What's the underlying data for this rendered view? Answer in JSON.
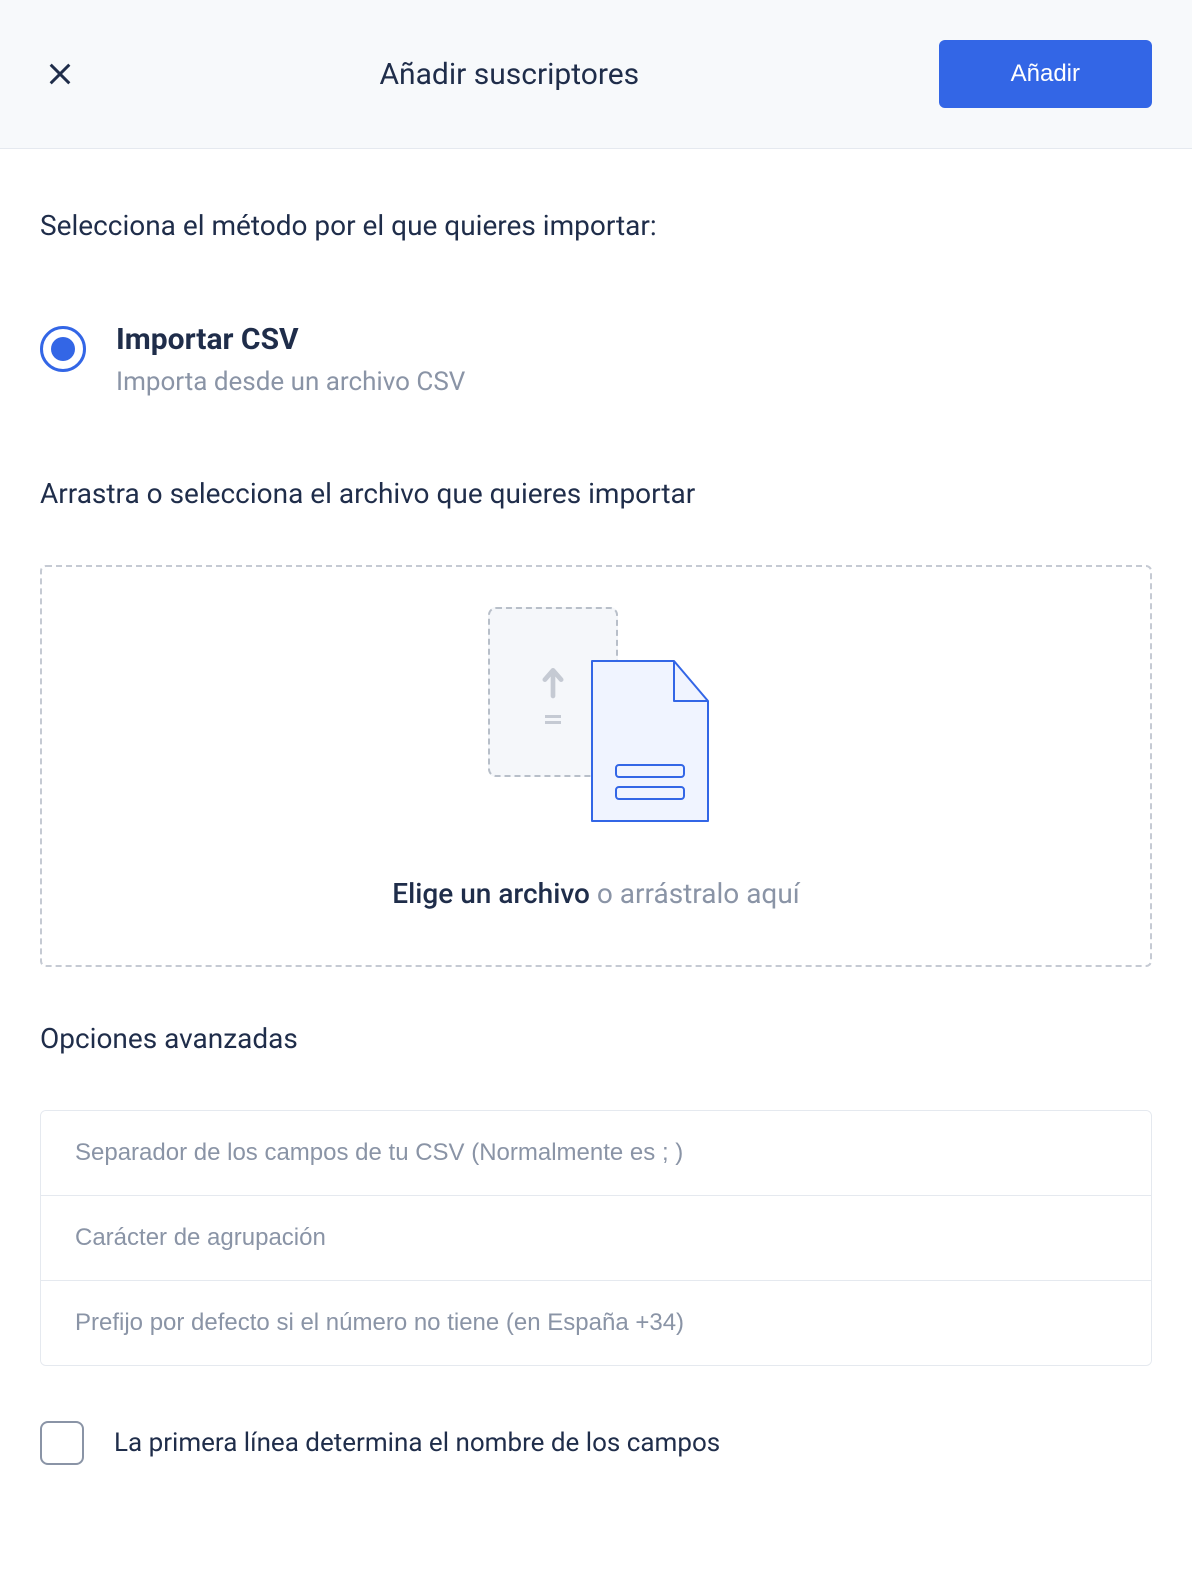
{
  "header": {
    "title": "Añadir suscriptores",
    "add_button": "Añadir"
  },
  "section": {
    "method_label": "Selecciona el método por el que quieres importar:",
    "import_csv": {
      "title": "Importar CSV",
      "description": "Importa desde un archivo CSV"
    },
    "upload_label": "Arrastra o selecciona el archivo que quieres importar",
    "dropzone": {
      "choose": "Elige un archivo",
      "or_drag": " o arrástralo aquí"
    },
    "advanced_label": "Opciones avanzadas",
    "inputs": {
      "separator_placeholder": "Separador de los campos de tu CSV (Normalmente es ; )",
      "grouping_placeholder": "Carácter de agrupación",
      "prefix_placeholder": "Prefijo por defecto si el número no tiene (en España +34)"
    },
    "checkbox_label": "La primera línea determina el nombre de los campos"
  }
}
